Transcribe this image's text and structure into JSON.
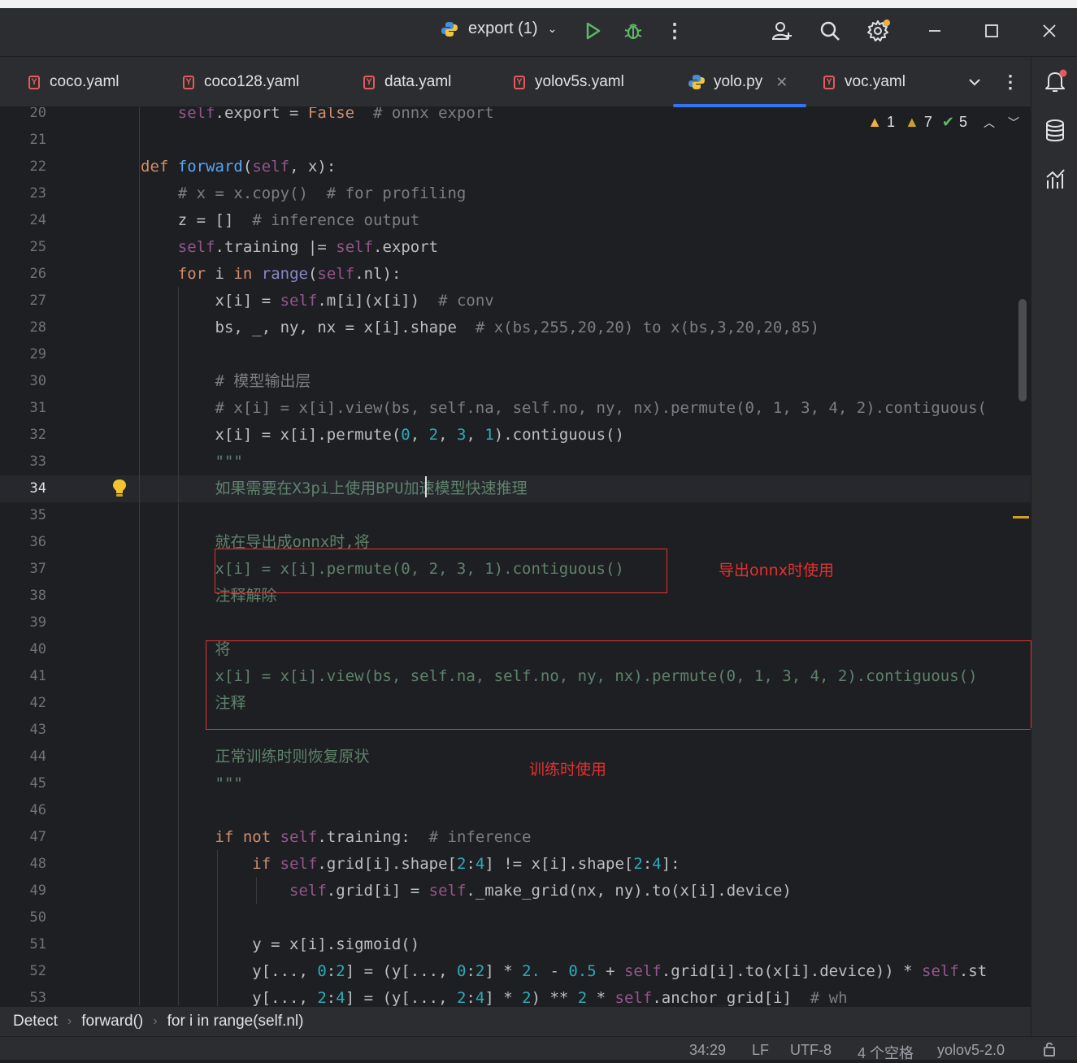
{
  "titlebar": {
    "run_config": "export (1)",
    "colors": {
      "run": "#5fb865",
      "debug": "#5fb865",
      "badge": "#f4b03c"
    }
  },
  "tabs": [
    {
      "label": "coco.yaml",
      "icon": "yaml-icon",
      "active": false
    },
    {
      "label": "coco128.yaml",
      "icon": "yaml-icon",
      "active": false
    },
    {
      "label": "data.yaml",
      "icon": "yaml-icon",
      "active": false
    },
    {
      "label": "yolov5s.yaml",
      "icon": "yaml-icon",
      "active": false
    },
    {
      "label": "yolo.py",
      "icon": "python-icon",
      "active": true
    },
    {
      "label": "voc.yaml",
      "icon": "yaml-icon",
      "active": false
    }
  ],
  "inspections": {
    "warnings_a": "1",
    "warnings_b": "7",
    "typos": "5"
  },
  "editor": {
    "lines": [
      {
        "n": "20",
        "html": "    <span class='sf'>self</span>.export = <span class='kw'>False</span>  <span class='cm'># onnx export</span>"
      },
      {
        "n": "21",
        "html": ""
      },
      {
        "n": "22",
        "html": "<span class='kw'>def</span> <span class='fn'>forward</span>(<span class='sf'>self</span>, x):"
      },
      {
        "n": "23",
        "html": "    <span class='cm'># x = x.copy()  # for profiling</span>"
      },
      {
        "n": "24",
        "html": "    z = []  <span class='cm'># inference output</span>"
      },
      {
        "n": "25",
        "html": "    <span class='sf'>self</span>.training |= <span class='sf'>self</span>.export"
      },
      {
        "n": "26",
        "html": "    <span class='kw'>for</span> i <span class='kw'>in</span> <span class='bi'>range</span>(<span class='sf'>self</span>.nl):"
      },
      {
        "n": "27",
        "html": "        x[i] = <span class='sf'>self</span>.m[i](x[i])  <span class='cm'># conv</span>"
      },
      {
        "n": "28",
        "html": "        bs, _, ny, nx = x[i].shape  <span class='cm'># x(bs,255,20,20) to x(bs,3,20,20,85)</span>"
      },
      {
        "n": "29",
        "html": ""
      },
      {
        "n": "30",
        "html": "        <span class='cm'># 模型输出层</span>"
      },
      {
        "n": "31",
        "html": "        <span class='cm'># x[i] = x[i].view(bs, self.na, self.no, ny, nx).permute(0, 1, 3, 4, 2).contiguous(</span>"
      },
      {
        "n": "32",
        "html": "        x[i] = x[i].permute(<span class='num'>0</span>, <span class='num'>2</span>, <span class='num'>3</span>, <span class='num'>1</span>).contiguous()"
      },
      {
        "n": "33",
        "html": "        <span class='doc'>\"\"\"</span>"
      },
      {
        "n": "34",
        "html": "        <span class='doc'>如果需要在X3pi上使用BPU加速模型快速推理</span>",
        "current": true
      },
      {
        "n": "35",
        "html": ""
      },
      {
        "n": "36",
        "html": "        <span class='doc'>就在导出成onnx时,将</span>"
      },
      {
        "n": "37",
        "html": "        <span class='doc'>x[i] = x[i].permute(0, 2, 3, 1).contiguous()</span>"
      },
      {
        "n": "38",
        "html": "        <span class='doc'>注释解除</span>"
      },
      {
        "n": "39",
        "html": ""
      },
      {
        "n": "40",
        "html": "        <span class='doc'>将</span>"
      },
      {
        "n": "41",
        "html": "        <span class='doc'>x[i] = x[i].view(bs, self.na, self.no, ny, nx).permute(0, 1, 3, 4, 2).contiguous()</span>"
      },
      {
        "n": "42",
        "html": "        <span class='doc'>注释</span>"
      },
      {
        "n": "43",
        "html": ""
      },
      {
        "n": "44",
        "html": "        <span class='doc'>正常训练时则恢复原状</span>"
      },
      {
        "n": "45",
        "html": "        <span class='doc'>\"\"\"</span>"
      },
      {
        "n": "46",
        "html": ""
      },
      {
        "n": "47",
        "html": "        <span class='kw'>if not</span> <span class='sf'>self</span>.training:  <span class='cm'># inference</span>"
      },
      {
        "n": "48",
        "html": "            <span class='kw'>if</span> <span class='sf'>self</span>.grid[i].shape[<span class='num'>2</span>:<span class='num'>4</span>] != x[i].shape[<span class='num'>2</span>:<span class='num'>4</span>]:"
      },
      {
        "n": "49",
        "html": "                <span class='sf'>self</span>.grid[i] = <span class='sf'>self</span>._make_grid(nx, ny).to(x[i].device)"
      },
      {
        "n": "50",
        "html": ""
      },
      {
        "n": "51",
        "html": "            y = x[i].sigmoid()"
      },
      {
        "n": "52",
        "html": "            y[..., <span class='num'>0</span>:<span class='num'>2</span>] = (y[..., <span class='num'>0</span>:<span class='num'>2</span>] * <span class='num'>2.</span> - <span class='num'>0.5</span> + <span class='sf'>self</span>.grid[i].to(x[i].device)) * <span class='sf'>self</span>.st"
      },
      {
        "n": "53",
        "html": "            y[..., <span class='num'>2</span>:<span class='num'>4</span>] = (y[..., <span class='num'>2</span>:<span class='num'>4</span>] * <span class='num'>2</span>) ** <span class='num'>2</span> * <span class='sf'>self</span>.anchor_grid[i]  <span class='cm'># wh</span>"
      }
    ]
  },
  "annotations": {
    "onnx_note": "导出onnx时使用",
    "train_note": "训练时使用"
  },
  "breadcrumbs": [
    "Detect",
    "forward()",
    "for i in range(self.nl)"
  ],
  "statusbar": {
    "position": "34:29",
    "line_ending": "LF",
    "encoding": "UTF-8",
    "indent": "4 个空格",
    "interpreter": "yolov5-2.0"
  }
}
